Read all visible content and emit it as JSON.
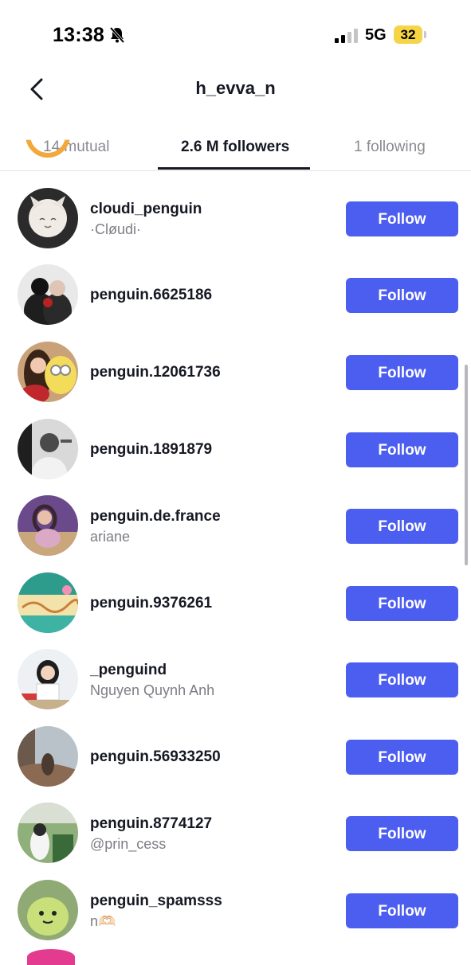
{
  "status_bar": {
    "time": "13:38",
    "network": "5G",
    "battery": "32"
  },
  "header": {
    "title": "h_evva_n"
  },
  "tabs": [
    {
      "label": "14 mutual",
      "active": false
    },
    {
      "label": "2.6 M followers",
      "active": true
    },
    {
      "label": "1 following",
      "active": false
    }
  ],
  "follow_label": "Follow",
  "users": [
    {
      "username": "cloudi_penguin",
      "display_name": "·Cløudi·"
    },
    {
      "username": "penguin.6625186",
      "display_name": ""
    },
    {
      "username": "penguin.12061736",
      "display_name": ""
    },
    {
      "username": "penguin.1891879",
      "display_name": ""
    },
    {
      "username": "penguin.de.france",
      "display_name": "ariane"
    },
    {
      "username": "penguin.9376261",
      "display_name": ""
    },
    {
      "username": "_penguind",
      "display_name": "Nguyen Quynh Anh"
    },
    {
      "username": "penguin.56933250",
      "display_name": ""
    },
    {
      "username": "penguin.8774127",
      "display_name": "@prin_cess"
    },
    {
      "username": "penguin_spamsss",
      "display_name": "n🫶🏻"
    }
  ],
  "colors": {
    "follow_button": "#4c5ef0",
    "battery": "#f5d547"
  }
}
